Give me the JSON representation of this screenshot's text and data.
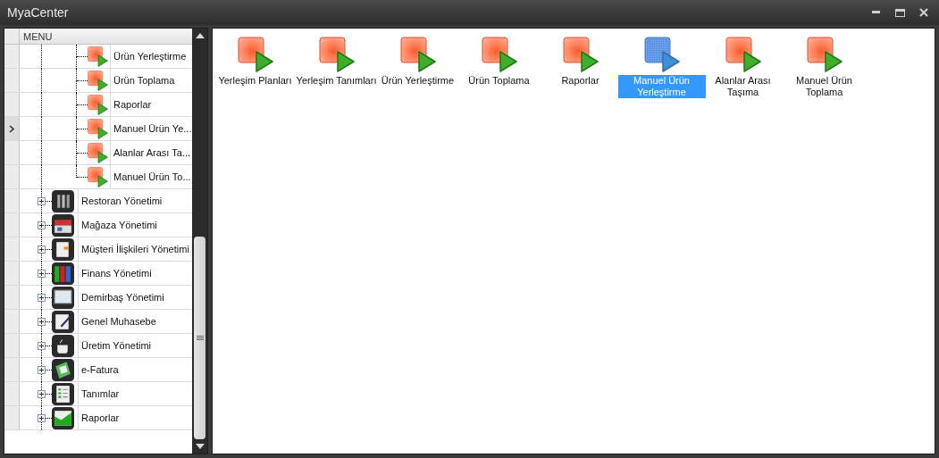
{
  "window": {
    "title": "MyaCenter"
  },
  "menu": {
    "header": "MENU",
    "open_module_items": [
      {
        "label": "Ürün Yerleştirme",
        "current": false
      },
      {
        "label": "Ürün Toplama",
        "current": false
      },
      {
        "label": "Raporlar",
        "current": false
      },
      {
        "label": "Manuel Ürün Ye...",
        "current": true
      },
      {
        "label": "Alanlar Arası Ta...",
        "current": false
      },
      {
        "label": "Manuel Ürün To...",
        "current": false
      }
    ],
    "modules": [
      {
        "label": "Restoran Yönetimi",
        "expanded": false,
        "current": false
      },
      {
        "label": "Mağaza Yönetimi",
        "expanded": false,
        "current": false
      },
      {
        "label": "Müşteri İlişkileri Yönetimi",
        "expanded": false,
        "current": false
      },
      {
        "label": "Finans Yönetimi",
        "expanded": false,
        "current": false
      },
      {
        "label": "Demirbaş Yönetimi",
        "expanded": false,
        "current": false
      },
      {
        "label": "Genel Muhasebe",
        "expanded": false,
        "current": false
      },
      {
        "label": "Üretim Yönetimi",
        "expanded": false,
        "current": false
      },
      {
        "label": "e-Fatura",
        "expanded": false,
        "current": false
      },
      {
        "label": "Tanımlar",
        "expanded": false,
        "current": false
      },
      {
        "label": "Raporlar",
        "expanded": false,
        "current": false
      }
    ]
  },
  "launcher": [
    {
      "label": "Yerleşim Planları",
      "selected": false
    },
    {
      "label": "Yerleşim Tanımları",
      "selected": false
    },
    {
      "label": "Ürün Yerleştirme",
      "selected": false
    },
    {
      "label": "Ürün Toplama",
      "selected": false
    },
    {
      "label": "Raporlar",
      "selected": false
    },
    {
      "label": "Manuel Ürün Yerleştirme",
      "selected": true
    },
    {
      "label": "Alanlar Arası Taşıma",
      "selected": false
    },
    {
      "label": "Manuel Ürün Toplama",
      "selected": false
    }
  ]
}
